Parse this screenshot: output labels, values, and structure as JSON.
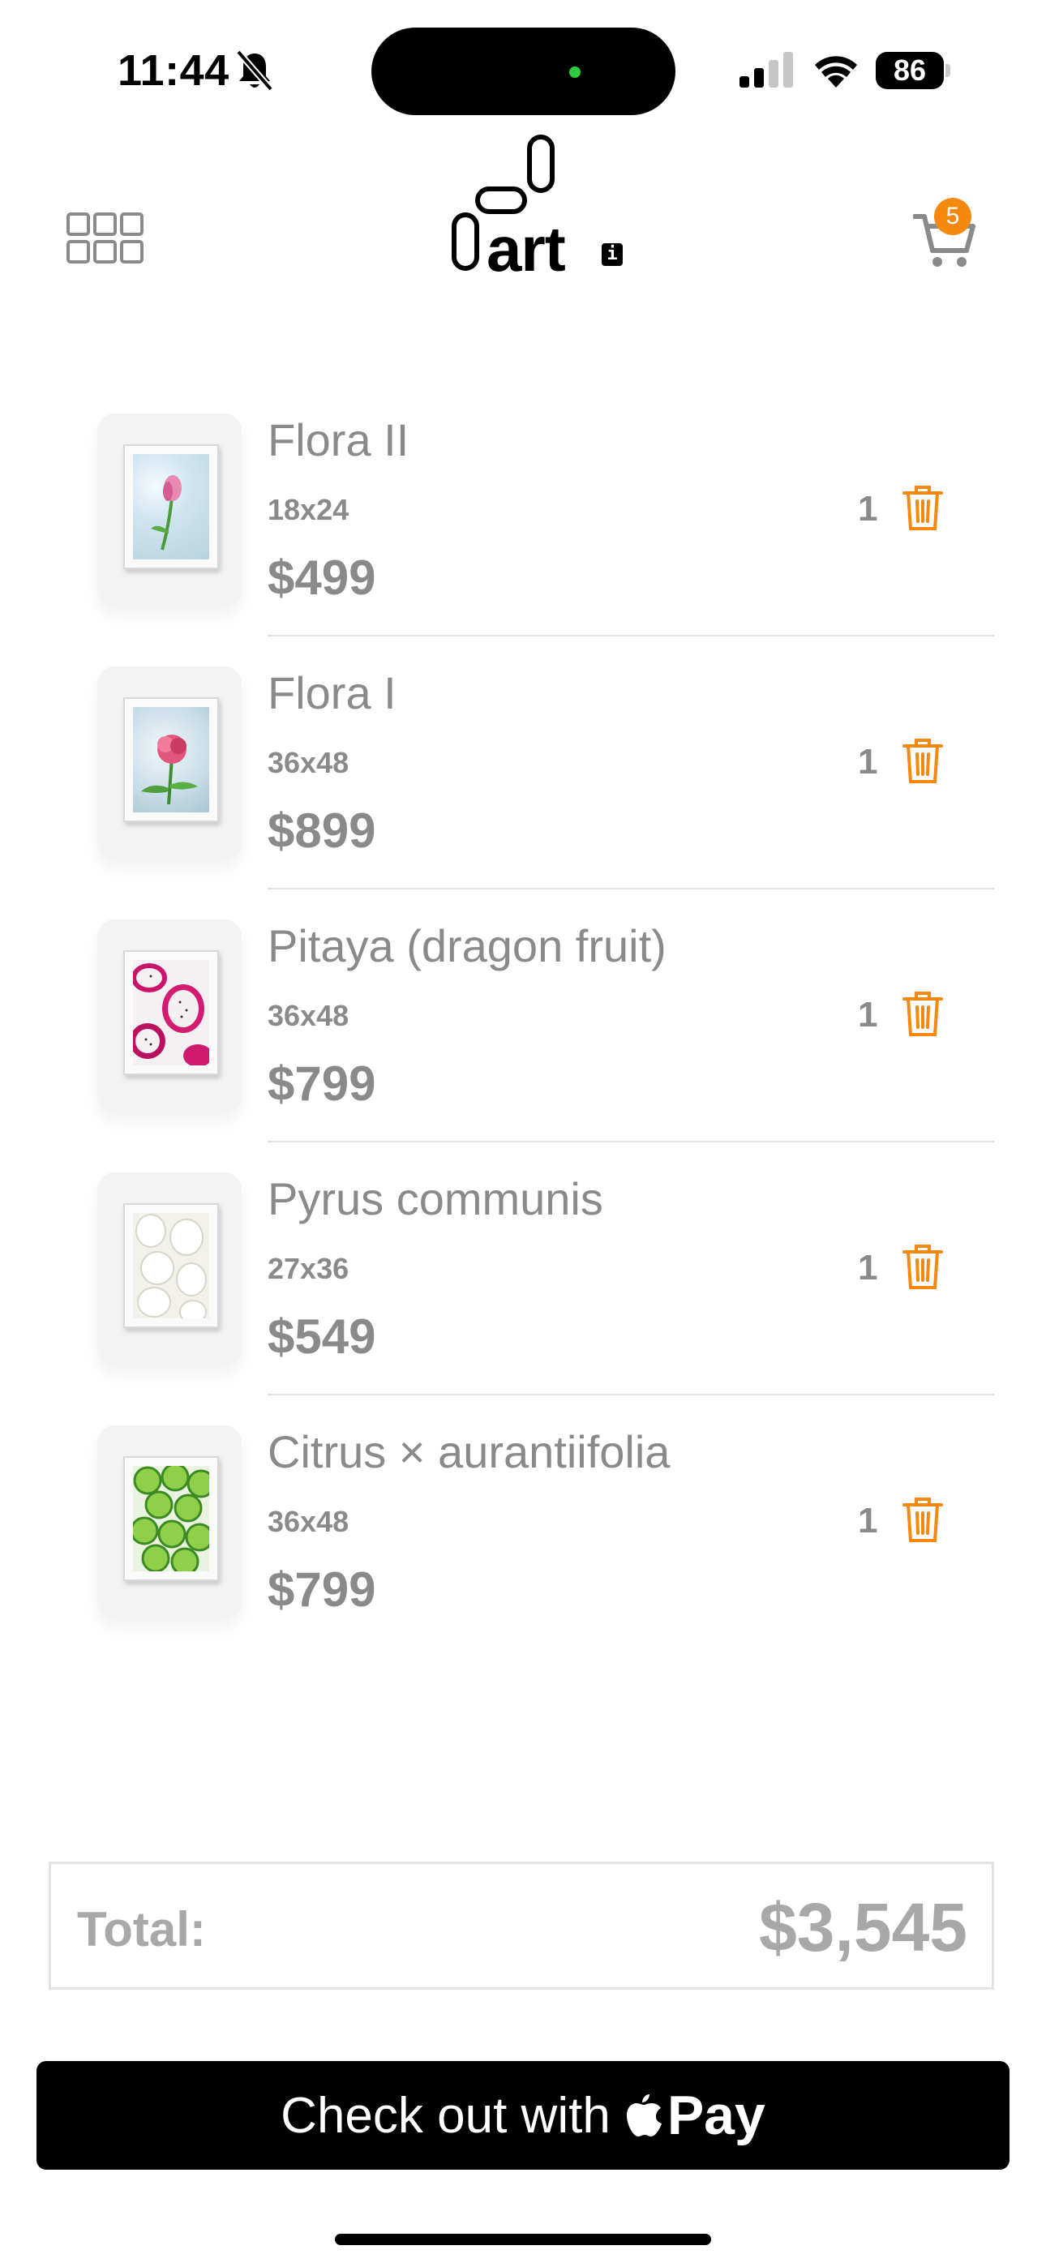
{
  "status_bar": {
    "time": "11:44",
    "battery": "86",
    "icons": [
      "bell-slash-icon",
      "signal-icon",
      "wifi-icon",
      "battery-icon"
    ]
  },
  "header": {
    "logo_text": "art",
    "logo_badge": "i",
    "cart_count": "5",
    "accent_color": "#f5890f"
  },
  "cart": {
    "items": [
      {
        "name": "Flora II",
        "size": "18x24",
        "price": "$499",
        "qty": "1"
      },
      {
        "name": "Flora I",
        "size": "36x48",
        "price": "$899",
        "qty": "1"
      },
      {
        "name": "Pitaya (dragon fruit)",
        "size": "36x48",
        "price": "$799",
        "qty": "1"
      },
      {
        "name": "Pyrus communis",
        "size": "27x36",
        "price": "$549",
        "qty": "1"
      },
      {
        "name": "Citrus × aurantiifolia",
        "size": "36x48",
        "price": "$799",
        "qty": "1"
      }
    ]
  },
  "summary": {
    "total_label": "Total:",
    "total_value": "$3,545"
  },
  "checkout": {
    "label": "Check out with",
    "pay_word": "Pay"
  }
}
